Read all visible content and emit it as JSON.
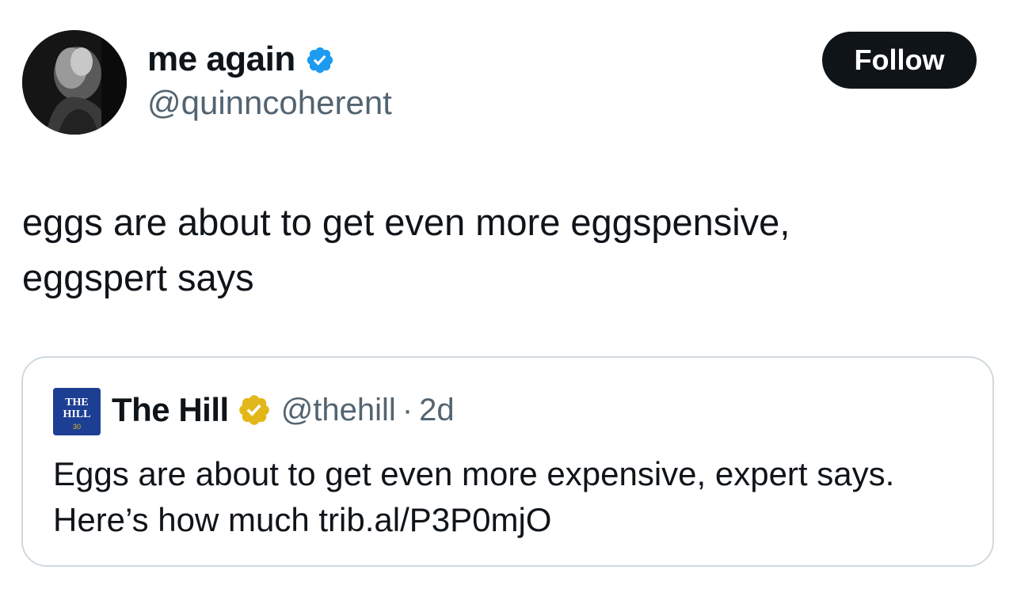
{
  "tweet": {
    "author": {
      "display_name": "me again",
      "handle": "@quinncoherent",
      "verified": true
    },
    "follow_label": "Follow",
    "text_lines": [
      "eggs are about to get even more eggspensive,",
      "eggspert says"
    ]
  },
  "quote": {
    "avatar_text": {
      "line1": "THE",
      "line2": "HILL",
      "line3": "30"
    },
    "author": {
      "display_name": "The Hill",
      "handle": "@thehill",
      "badge": "gold-verified"
    },
    "separator": "·",
    "time": "2d",
    "text_lines": [
      "Eggs are about to get even more expensive, expert says.",
      "Here’s how much trib.al/P3P0mjO"
    ]
  },
  "colors": {
    "text": "#0f1419",
    "secondary": "#536471",
    "blue_verified": "#1d9bf0",
    "gold_verified": "#e2b719",
    "border": "#cfd9de",
    "follow_bg": "#0f1419",
    "hill_blue": "#1c3f94"
  }
}
